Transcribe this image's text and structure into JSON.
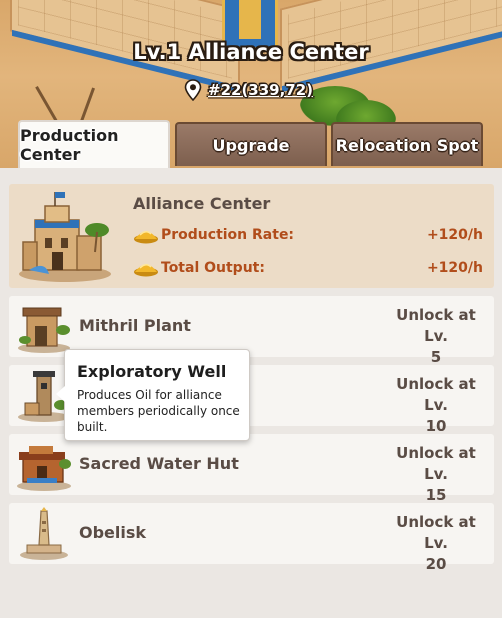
{
  "header": {
    "title": "Lv.1 Alliance Center",
    "coordinates": "#22(339,72)"
  },
  "tabs": [
    {
      "label": "Production Center",
      "active": true
    },
    {
      "label": "Upgrade",
      "active": false
    },
    {
      "label": "Relocation Spot",
      "active": false
    }
  ],
  "featured": {
    "name": "Alliance Center",
    "production_rate_label": "Production Rate:",
    "production_rate_value": "+120/h",
    "total_output_label": "Total Output:",
    "total_output_value": "+120/h"
  },
  "buildings": [
    {
      "name": "Mithril Plant",
      "unlock_label": "Unlock at Lv.",
      "unlock_level": "5"
    },
    {
      "name": "Exploratory Well",
      "unlock_label": "Unlock at Lv.",
      "unlock_level": "10"
    },
    {
      "name": "Sacred Water Hut",
      "unlock_label": "Unlock at Lv.",
      "unlock_level": "15"
    },
    {
      "name": "Obelisk",
      "unlock_label": "Unlock at Lv.",
      "unlock_level": "20"
    }
  ],
  "tooltip": {
    "title": "Exploratory Well",
    "description": "Produces Oil for alliance members periodically once built."
  },
  "colors": {
    "accent_text": "#b14d1b",
    "featured_bg": "#ecdcc7",
    "tab_inactive": "#7d5f4e"
  }
}
